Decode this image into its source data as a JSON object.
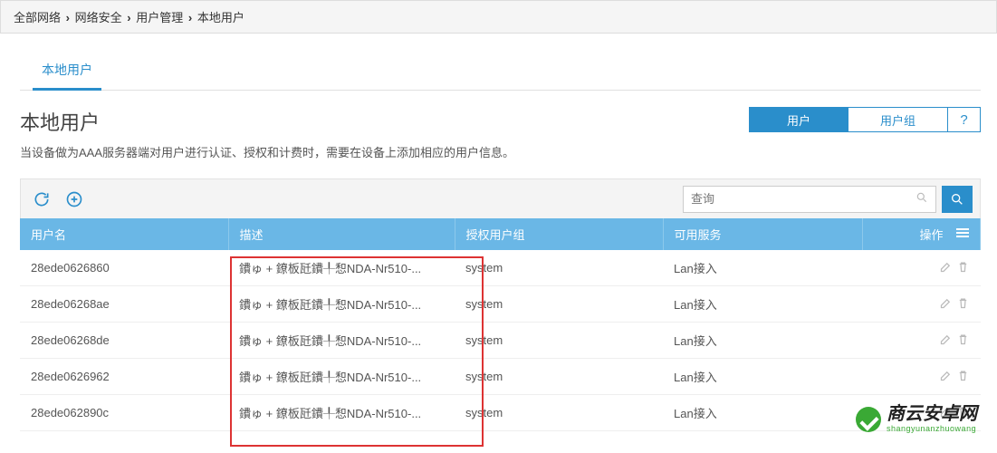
{
  "breadcrumb": [
    "全部网络",
    "网络安全",
    "用户管理",
    "本地用户"
  ],
  "tabs": [
    {
      "label": "本地用户",
      "active": true
    }
  ],
  "page": {
    "title": "本地用户",
    "subtitle": "当设备做为AAA服务器端对用户进行认证、授权和计费时，需要在设备上添加相应的用户信息。"
  },
  "pill_tabs": {
    "user": "用户",
    "usergroup": "用户组"
  },
  "search": {
    "placeholder": "查询"
  },
  "columns": {
    "username": "用户名",
    "description": "描述",
    "auth_group": "授权用户组",
    "service": "可用服务",
    "ops": "操作"
  },
  "rows": [
    {
      "username": "28ede0626860",
      "description": "鐨ゅ + 鐐板瓩鐨╀惒NDA-Nr510-...",
      "group": "system",
      "service": "Lan接入"
    },
    {
      "username": "28ede06268ae",
      "description": "鐨ゅ + 鐐板瓩鐨╀惒NDA-Nr510-...",
      "group": "system",
      "service": "Lan接入"
    },
    {
      "username": "28ede06268de",
      "description": "鐨ゅ + 鐐板瓩鐨╀惒NDA-Nr510-...",
      "group": "system",
      "service": "Lan接入"
    },
    {
      "username": "28ede0626962",
      "description": "鐨ゅ + 鐐板瓩鐨╀惒NDA-Nr510-...",
      "group": "system",
      "service": "Lan接入"
    },
    {
      "username": "28ede062890c",
      "description": "鐨ゅ + 鐐板瓩鐨╀惒NDA-Nr510-...",
      "group": "system",
      "service": "Lan接入"
    }
  ],
  "watermark": {
    "cn": "商云安卓网",
    "py": "shangyunanzhuowang"
  }
}
